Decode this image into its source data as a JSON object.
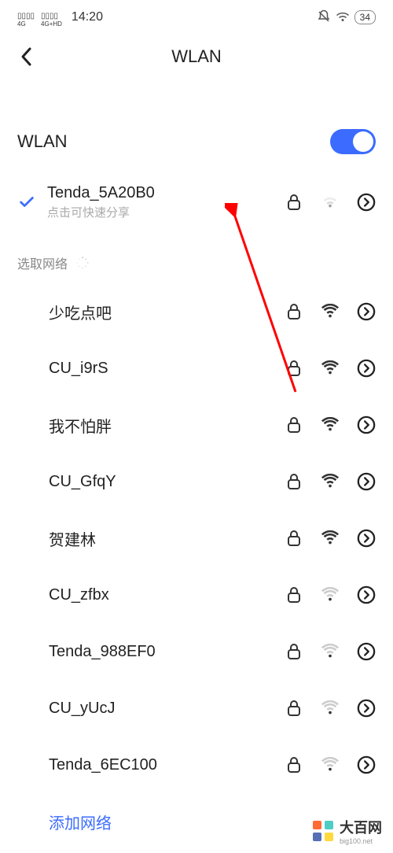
{
  "statusBar": {
    "signal1": "4G",
    "signal2": "4G+HD",
    "time": "14:20",
    "battery": "34"
  },
  "header": {
    "title": "WLAN"
  },
  "wlanToggle": {
    "label": "WLAN",
    "enabled": true
  },
  "connected": {
    "name": "Tenda_5A20B0",
    "subtitle": "点击可快速分享"
  },
  "sectionHeader": "选取网络",
  "networks": [
    {
      "name": "少吃点吧",
      "strength": "strong",
      "locked": true
    },
    {
      "name": "CU_i9rS",
      "strength": "strong",
      "locked": true
    },
    {
      "name": "我不怕胖",
      "strength": "strong",
      "locked": true
    },
    {
      "name": "CU_GfqY",
      "strength": "strong",
      "locked": true
    },
    {
      "name": "贺建林",
      "strength": "strong",
      "locked": true
    },
    {
      "name": "CU_zfbx",
      "strength": "weak",
      "locked": true
    },
    {
      "name": "Tenda_988EF0",
      "strength": "weak",
      "locked": true
    },
    {
      "name": "CU_yUcJ",
      "strength": "weak",
      "locked": true
    },
    {
      "name": "Tenda_6EC100",
      "strength": "weak",
      "locked": true
    }
  ],
  "addNetwork": "添加网络",
  "watermark": {
    "text": "大百网",
    "sub": "big100.net"
  }
}
